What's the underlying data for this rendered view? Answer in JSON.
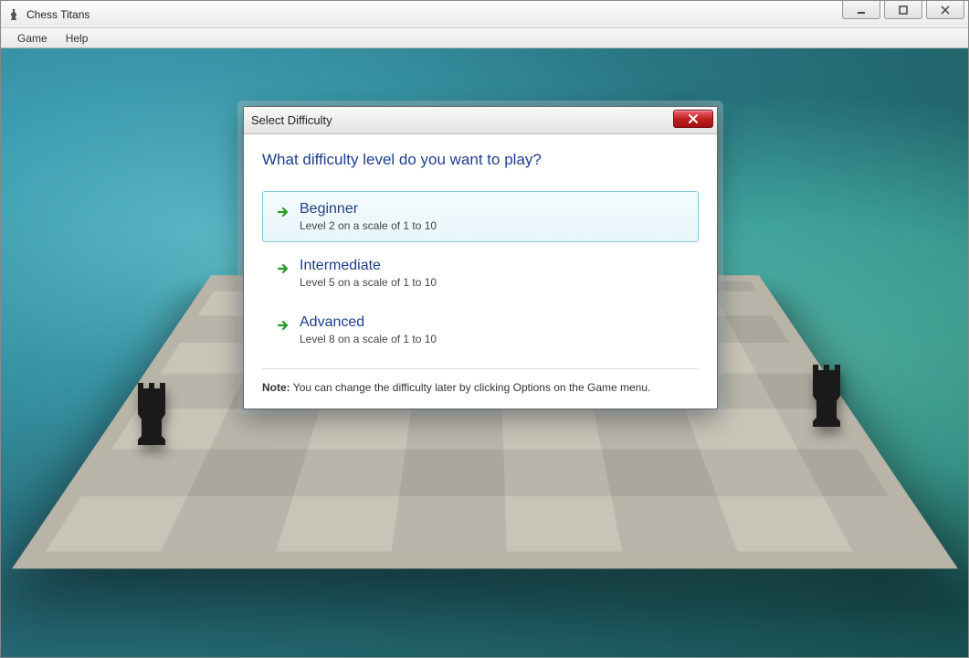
{
  "window": {
    "title": "Chess Titans"
  },
  "menubar": {
    "game": "Game",
    "help": "Help"
  },
  "dialog": {
    "title": "Select Difficulty",
    "heading": "What difficulty level do you want to play?",
    "options": [
      {
        "title": "Beginner",
        "subtitle": "Level 2 on a scale of 1 to 10"
      },
      {
        "title": "Intermediate",
        "subtitle": "Level 5 on a scale of 1 to 10"
      },
      {
        "title": "Advanced",
        "subtitle": "Level 8 on a scale of 1 to 10"
      }
    ],
    "note_label": "Note:",
    "note_text": " You can change the difficulty later by clicking Options on the Game menu."
  }
}
